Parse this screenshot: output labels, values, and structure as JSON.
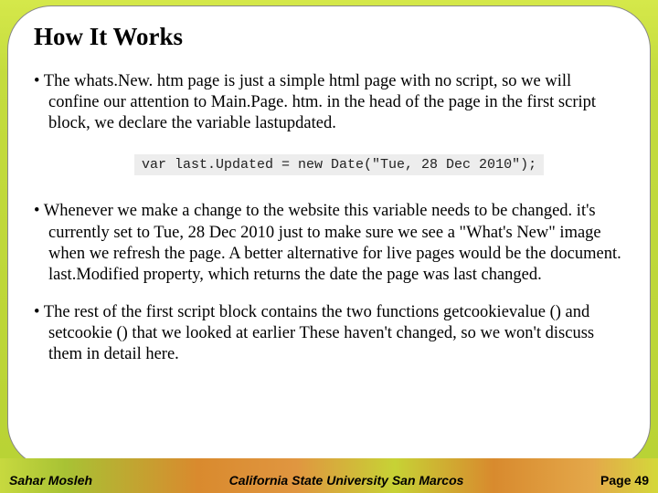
{
  "title": "How It Works",
  "bullets": {
    "b1": "The whats.New. htm page is just a simple html page with no script, so we will confine our attention to Main.Page. htm. in the head of the page in the first script block, we declare the variable lastupdated.",
    "code": "var last.Updated = new Date(\"Tue, 28 Dec 2010\");",
    "b2": "Whenever we make a change to the website this variable needs to be changed. it's currently set to Tue, 28 Dec 2010 just to make sure we see a \"What's New\" image when we refresh the page. A better alternative for live pages would be the document. last.Modified property, which returns the date the page was last changed.",
    "b3": "The rest of the first script block contains the two functions getcookievalue () and setcookie () that we looked at earlier These haven't changed, so we won't discuss them in detail here."
  },
  "footer": {
    "left": "Sahar Mosleh",
    "center": "California State University San Marcos",
    "right_label": "Page",
    "page_number": "49"
  }
}
